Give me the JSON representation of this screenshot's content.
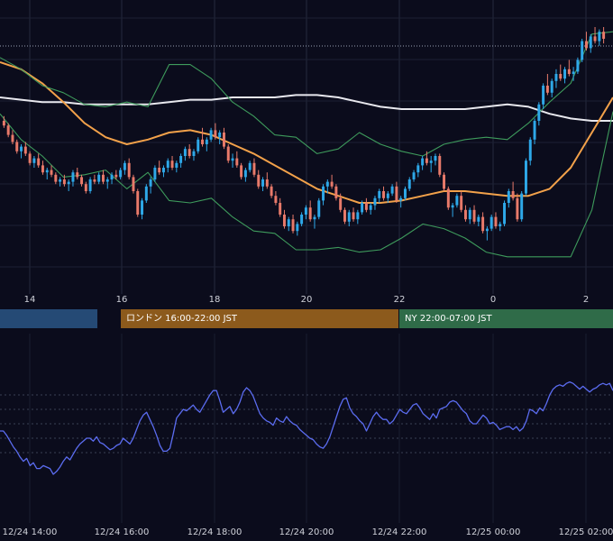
{
  "chart_data": [
    {
      "type": "candlestick",
      "title": "",
      "x_ticks": [
        "14",
        "16",
        "18",
        "20",
        "22",
        "0",
        "2"
      ],
      "y_range": [
        0,
        100
      ],
      "grid": true,
      "candles": [
        [
          60,
          62,
          57,
          58
        ],
        [
          58,
          59,
          53,
          54
        ],
        [
          54,
          56,
          50,
          51
        ],
        [
          51,
          52,
          46,
          47
        ],
        [
          47,
          50,
          44,
          49
        ],
        [
          49,
          51,
          45,
          46
        ],
        [
          46,
          47,
          41,
          42
        ],
        [
          42,
          45,
          40,
          44
        ],
        [
          44,
          46,
          40,
          41
        ],
        [
          41,
          43,
          37,
          38
        ],
        [
          38,
          40,
          35,
          39
        ],
        [
          39,
          41,
          36,
          37
        ],
        [
          37,
          38,
          33,
          34
        ],
        [
          34,
          36,
          32,
          35
        ],
        [
          35,
          37,
          32,
          33
        ],
        [
          33,
          35,
          30,
          34
        ],
        [
          34,
          39,
          32,
          38
        ],
        [
          38,
          40,
          35,
          36
        ],
        [
          36,
          37,
          32,
          33
        ],
        [
          33,
          34,
          29,
          30
        ],
        [
          30,
          36,
          29,
          35
        ],
        [
          35,
          37,
          33,
          34
        ],
        [
          34,
          38,
          33,
          37
        ],
        [
          37,
          39,
          33,
          34
        ],
        [
          34,
          36,
          31,
          35
        ],
        [
          35,
          38,
          33,
          37
        ],
        [
          37,
          39,
          35,
          36
        ],
        [
          36,
          40,
          35,
          39
        ],
        [
          39,
          43,
          37,
          42
        ],
        [
          42,
          44,
          35,
          36
        ],
        [
          36,
          37,
          29,
          30
        ],
        [
          30,
          31,
          19,
          20
        ],
        [
          20,
          27,
          18,
          26
        ],
        [
          26,
          33,
          25,
          32
        ],
        [
          32,
          36,
          29,
          35
        ],
        [
          35,
          41,
          34,
          40
        ],
        [
          40,
          43,
          37,
          38
        ],
        [
          38,
          41,
          36,
          40
        ],
        [
          40,
          44,
          38,
          43
        ],
        [
          43,
          45,
          39,
          40
        ],
        [
          40,
          43,
          38,
          42
        ],
        [
          42,
          46,
          40,
          45
        ],
        [
          45,
          49,
          43,
          48
        ],
        [
          48,
          50,
          44,
          45
        ],
        [
          45,
          48,
          43,
          47
        ],
        [
          47,
          53,
          46,
          52
        ],
        [
          52,
          57,
          49,
          50
        ],
        [
          50,
          53,
          47,
          52
        ],
        [
          52,
          57,
          51,
          56
        ],
        [
          56,
          59,
          52,
          53
        ],
        [
          53,
          56,
          50,
          55
        ],
        [
          55,
          57,
          48,
          49
        ],
        [
          49,
          50,
          42,
          43
        ],
        [
          43,
          46,
          40,
          44
        ],
        [
          44,
          47,
          40,
          41
        ],
        [
          41,
          42,
          35,
          36
        ],
        [
          36,
          40,
          34,
          39
        ],
        [
          39,
          43,
          38,
          42
        ],
        [
          42,
          44,
          36,
          37
        ],
        [
          37,
          39,
          31,
          32
        ],
        [
          32,
          36,
          30,
          35
        ],
        [
          35,
          38,
          31,
          32
        ],
        [
          32,
          33,
          27,
          28
        ],
        [
          28,
          30,
          24,
          25
        ],
        [
          25,
          27,
          19,
          20
        ],
        [
          20,
          22,
          14,
          15
        ],
        [
          15,
          19,
          13,
          18
        ],
        [
          18,
          20,
          12,
          13
        ],
        [
          13,
          17,
          11,
          16
        ],
        [
          16,
          21,
          15,
          20
        ],
        [
          20,
          24,
          18,
          23
        ],
        [
          23,
          26,
          17,
          18
        ],
        [
          18,
          20,
          14,
          19
        ],
        [
          19,
          27,
          18,
          26
        ],
        [
          26,
          33,
          24,
          32
        ],
        [
          32,
          35,
          29,
          34
        ],
        [
          34,
          37,
          31,
          32
        ],
        [
          32,
          33,
          26,
          27
        ],
        [
          27,
          29,
          21,
          22
        ],
        [
          22,
          23,
          16,
          17
        ],
        [
          17,
          22,
          15,
          21
        ],
        [
          21,
          23,
          17,
          18
        ],
        [
          18,
          22,
          16,
          21
        ],
        [
          21,
          26,
          20,
          25
        ],
        [
          25,
          27,
          21,
          22
        ],
        [
          22,
          25,
          20,
          24
        ],
        [
          24,
          28,
          22,
          27
        ],
        [
          27,
          31,
          25,
          30
        ],
        [
          30,
          32,
          26,
          27
        ],
        [
          27,
          30,
          25,
          29
        ],
        [
          29,
          33,
          28,
          32
        ],
        [
          32,
          34,
          25,
          26
        ],
        [
          26,
          28,
          23,
          27
        ],
        [
          27,
          32,
          26,
          31
        ],
        [
          31,
          36,
          30,
          35
        ],
        [
          35,
          39,
          34,
          38
        ],
        [
          38,
          42,
          36,
          41
        ],
        [
          41,
          45,
          39,
          44
        ],
        [
          44,
          47,
          41,
          42
        ],
        [
          42,
          45,
          38,
          43
        ],
        [
          43,
          46,
          41,
          45
        ],
        [
          45,
          46,
          36,
          37
        ],
        [
          37,
          38,
          30,
          31
        ],
        [
          31,
          32,
          22,
          23
        ],
        [
          23,
          25,
          19,
          24
        ],
        [
          24,
          29,
          23,
          28
        ],
        [
          28,
          30,
          21,
          22
        ],
        [
          22,
          24,
          17,
          18
        ],
        [
          18,
          23,
          16,
          22
        ],
        [
          22,
          24,
          16,
          17
        ],
        [
          17,
          20,
          15,
          19
        ],
        [
          19,
          21,
          12,
          13
        ],
        [
          13,
          15,
          9,
          14
        ],
        [
          14,
          20,
          13,
          19
        ],
        [
          19,
          21,
          14,
          15
        ],
        [
          15,
          17,
          13,
          16
        ],
        [
          16,
          26,
          15,
          25
        ],
        [
          25,
          31,
          23,
          30
        ],
        [
          30,
          34,
          26,
          27
        ],
        [
          27,
          29,
          17,
          18
        ],
        [
          18,
          30,
          17,
          29
        ],
        [
          29,
          44,
          28,
          43
        ],
        [
          43,
          53,
          41,
          52
        ],
        [
          52,
          61,
          50,
          60
        ],
        [
          60,
          68,
          58,
          67
        ],
        [
          67,
          76,
          65,
          75
        ],
        [
          75,
          80,
          71,
          72
        ],
        [
          72,
          78,
          70,
          77
        ],
        [
          77,
          82,
          74,
          80
        ],
        [
          80,
          84,
          77,
          78
        ],
        [
          78,
          83,
          76,
          82
        ],
        [
          82,
          86,
          79,
          80
        ],
        [
          80,
          83,
          77,
          81
        ],
        [
          81,
          87,
          80,
          86
        ],
        [
          86,
          95,
          85,
          94
        ],
        [
          94,
          98,
          90,
          91
        ],
        [
          91,
          97,
          89,
          96
        ],
        [
          96,
          100,
          93,
          94
        ],
        [
          94,
          99,
          92,
          98
        ],
        [
          98,
          100,
          93,
          95
        ]
      ],
      "overlays": [
        {
          "name": "",
          "color": "#e8e8ee",
          "values": [
            70,
            69,
            68,
            68,
            67,
            67,
            67,
            67,
            68,
            69,
            69,
            70,
            70,
            70,
            71,
            71,
            70,
            68,
            66,
            65,
            65,
            65,
            65,
            66,
            67,
            66,
            63,
            61,
            60,
            60
          ]
        },
        {
          "name": "",
          "color": "#f2a14a",
          "values": [
            85,
            82,
            76,
            68,
            59,
            53,
            50,
            52,
            55,
            56,
            54,
            50,
            46,
            41,
            36,
            31,
            28,
            25,
            25,
            26,
            28,
            30,
            30,
            29,
            28,
            28,
            31,
            40,
            55,
            70
          ]
        },
        {
          "name": "",
          "color": "#3e9b5c",
          "values": [
            87,
            82,
            75,
            72,
            67,
            66,
            68,
            66,
            84,
            84,
            78,
            68,
            62,
            54,
            53,
            46,
            48,
            55,
            50,
            47,
            45,
            50,
            52,
            53,
            52,
            59,
            68,
            76,
            97,
            98
          ]
        },
        {
          "name": "",
          "color": "#3e9b5c",
          "values": [
            63,
            52,
            45,
            36,
            37,
            39,
            31,
            38,
            26,
            25,
            27,
            19,
            13,
            12,
            5,
            5,
            6,
            4,
            5,
            10,
            16,
            14,
            10,
            4,
            2,
            2,
            2,
            2,
            22,
            64
          ]
        }
      ],
      "ref_line_value": 92
    },
    {
      "type": "line",
      "title": "",
      "x_ticks": [
        "12/24 14:00",
        "12/24 16:00",
        "12/24 18:00",
        "12/24 20:00",
        "12/24 22:00",
        "12/25 00:00",
        "12/25 02:00"
      ],
      "ylim": [
        0,
        100
      ],
      "grid": true,
      "series": [
        {
          "name": "",
          "color": "#5b6cf0",
          "values": [
            45,
            45,
            42,
            38,
            34,
            31,
            27,
            24,
            26,
            21,
            23,
            19,
            19,
            21,
            20,
            19,
            15,
            17,
            20,
            24,
            27,
            25,
            29,
            33,
            36,
            38,
            40,
            40,
            38,
            41,
            37,
            36,
            34,
            32,
            33,
            35,
            36,
            40,
            38,
            36,
            40,
            46,
            52,
            56,
            58,
            53,
            48,
            42,
            35,
            31,
            31,
            33,
            43,
            54,
            57,
            60,
            59,
            61,
            63,
            60,
            58,
            62,
            66,
            70,
            73,
            73,
            66,
            58,
            60,
            62,
            57,
            60,
            65,
            72,
            75,
            73,
            69,
            63,
            57,
            54,
            52,
            51,
            49,
            54,
            52,
            51,
            55,
            52,
            50,
            49,
            46,
            44,
            42,
            40,
            39,
            36,
            34,
            33,
            36,
            41,
            48,
            55,
            62,
            67,
            68,
            61,
            57,
            55,
            52,
            50,
            45,
            50,
            55,
            58,
            55,
            53,
            53,
            50,
            52,
            56,
            60,
            58,
            57,
            60,
            63,
            64,
            61,
            57,
            55,
            53,
            57,
            54,
            60,
            61,
            62,
            65,
            66,
            65,
            62,
            59,
            57,
            52,
            50,
            50,
            53,
            56,
            54,
            50,
            51,
            49,
            46,
            47,
            48,
            48,
            46,
            48,
            45,
            47,
            52,
            60,
            59,
            57,
            61,
            59,
            64,
            70,
            74,
            76,
            77,
            76,
            78,
            79,
            78,
            76,
            74,
            76,
            74,
            72,
            74,
            75,
            77,
            78,
            77,
            78,
            73
          ]
        }
      ],
      "ref_lines": [
        70,
        60,
        50,
        40,
        30
      ]
    }
  ],
  "sessions": [
    {
      "label": "",
      "color": "#254a75"
    },
    {
      "label": "ロンドン 16:00-22:00 JST",
      "color": "#8c5a1c"
    },
    {
      "label": "NY 22:00-07:00 JST",
      "color": "#2f6b48"
    }
  ]
}
